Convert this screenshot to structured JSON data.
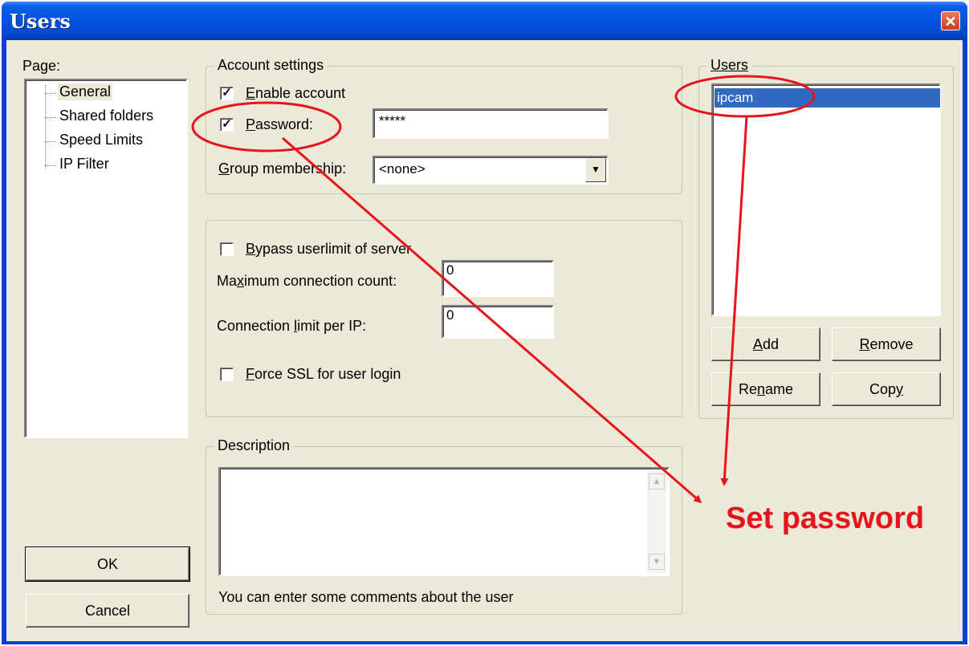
{
  "window": {
    "title": "Users"
  },
  "page_panel": {
    "label": "Page:",
    "items": [
      "General",
      "Shared folders",
      "Speed Limits",
      "IP Filter"
    ]
  },
  "account_settings": {
    "legend": "Account settings",
    "enable_account_prefix": "",
    "enable_account_mnemonic": "E",
    "enable_account_rest": "nable account",
    "enable_account_checked": true,
    "password_mnemonic": "P",
    "password_rest": "assword:",
    "password_checked": true,
    "password_value": "*****",
    "group_label_mnemonic": "G",
    "group_label_rest": "roup membership:",
    "group_value": "<none>"
  },
  "limits": {
    "bypass_mnemonic": "B",
    "bypass_rest": "ypass userlimit of server",
    "bypass_checked": false,
    "max_conn_pre": "Ma",
    "max_conn_mnemonic": "x",
    "max_conn_rest": "imum connection count:",
    "max_conn_value": "0",
    "limit_ip_pre": "Connection ",
    "limit_ip_mnemonic": "l",
    "limit_ip_rest": "imit per IP:",
    "limit_ip_value": "0",
    "ssl_mnemonic": "F",
    "ssl_rest": "orce SSL for user login",
    "ssl_checked": false
  },
  "description": {
    "legend": "Description",
    "hint": "You can enter some comments about the user"
  },
  "buttons": {
    "ok": "OK",
    "cancel": "Cancel"
  },
  "users_panel": {
    "legend": "Users",
    "items": [
      "ipcam"
    ],
    "add_mnemonic": "A",
    "add_rest": "dd",
    "remove_mnemonic": "R",
    "remove_rest": "emove",
    "rename_pre": "Re",
    "rename_mnemonic": "n",
    "rename_rest": "ame",
    "copy_pre": "Cop",
    "copy_mnemonic": "y"
  },
  "annotation": {
    "text": "Set password",
    "color": "#e8141c"
  },
  "icons": {
    "close": "close-icon",
    "dropdown": "chevron-down-icon"
  },
  "colors": {
    "title_bar": "#0552e0",
    "selection": "#316ac5",
    "dialog_bg": "#ece9d8"
  }
}
